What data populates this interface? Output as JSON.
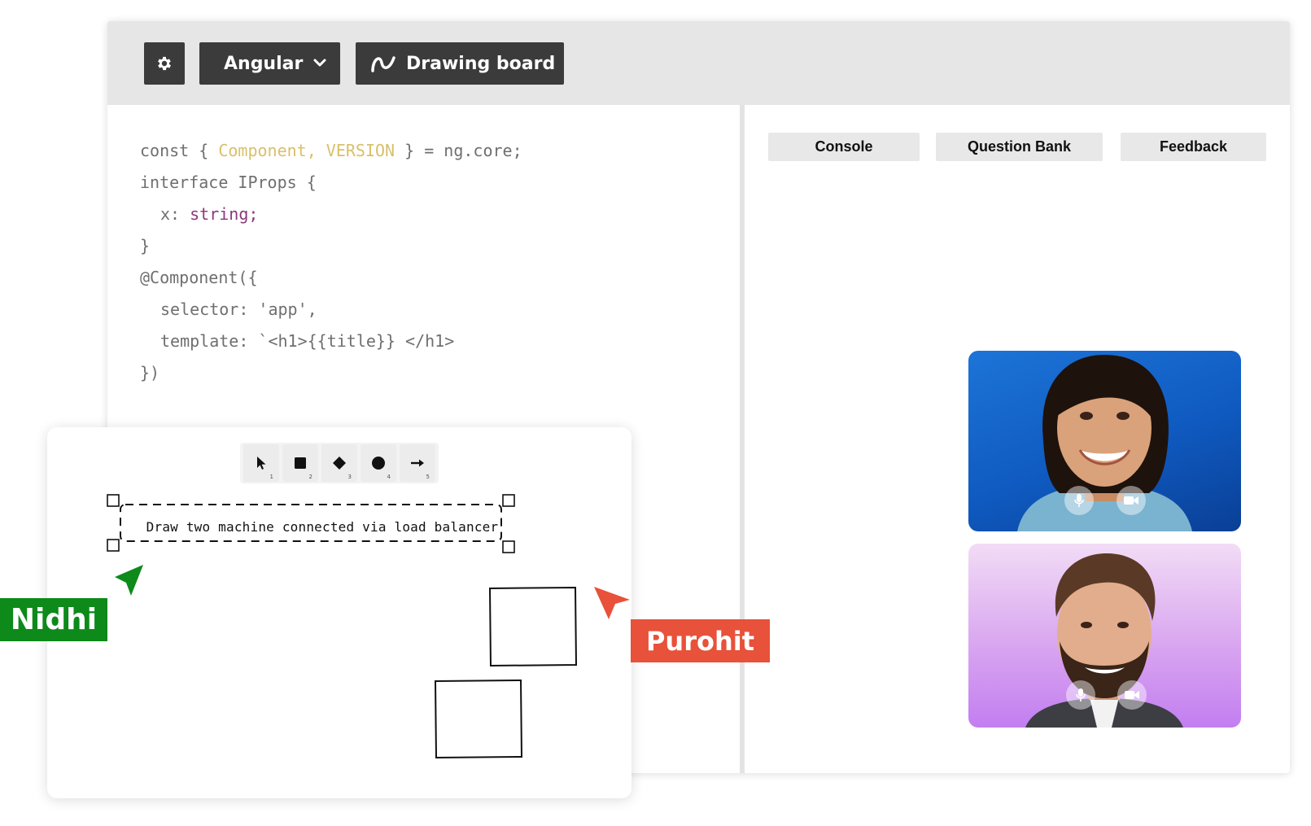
{
  "toolbar": {
    "settings_icon": "gear-icon",
    "framework_label": "Angular",
    "drawing_board_label": "Drawing board"
  },
  "editor": {
    "lines": [
      {
        "plain1": "const { ",
        "yellow": "Component, VERSION",
        "plain2": " } = ng.core;"
      },
      {
        "text": "interface IProps {"
      },
      {
        "key": "x: ",
        "purple": "string;"
      },
      {
        "text": "}"
      },
      {
        "text": "@Component({"
      },
      {
        "text": "selector: 'app',"
      },
      {
        "text": "template: `<h1>{{title}} </h1>"
      },
      {
        "text": "})"
      }
    ]
  },
  "tabs": {
    "console": "Console",
    "question_bank": "Question Bank",
    "feedback": "Feedback"
  },
  "video_tiles": [
    {
      "controls": [
        "mic-icon",
        "camera-icon"
      ]
    },
    {
      "controls": [
        "mic-icon",
        "camera-icon"
      ]
    }
  ],
  "board": {
    "tools": [
      {
        "icon": "pointer-icon",
        "shortcut": "1"
      },
      {
        "icon": "square-icon",
        "shortcut": "2"
      },
      {
        "icon": "diamond-icon",
        "shortcut": "3"
      },
      {
        "icon": "circle-icon",
        "shortcut": "4"
      },
      {
        "icon": "arrow-icon",
        "shortcut": "5"
      }
    ],
    "prompt_text": "Draw two machine connected via load balancer"
  },
  "cursors": {
    "nidhi": {
      "name": "Nidhi",
      "color": "#0d8a1a"
    },
    "purohit": {
      "name": "Purohit",
      "color": "#e8513a"
    }
  }
}
